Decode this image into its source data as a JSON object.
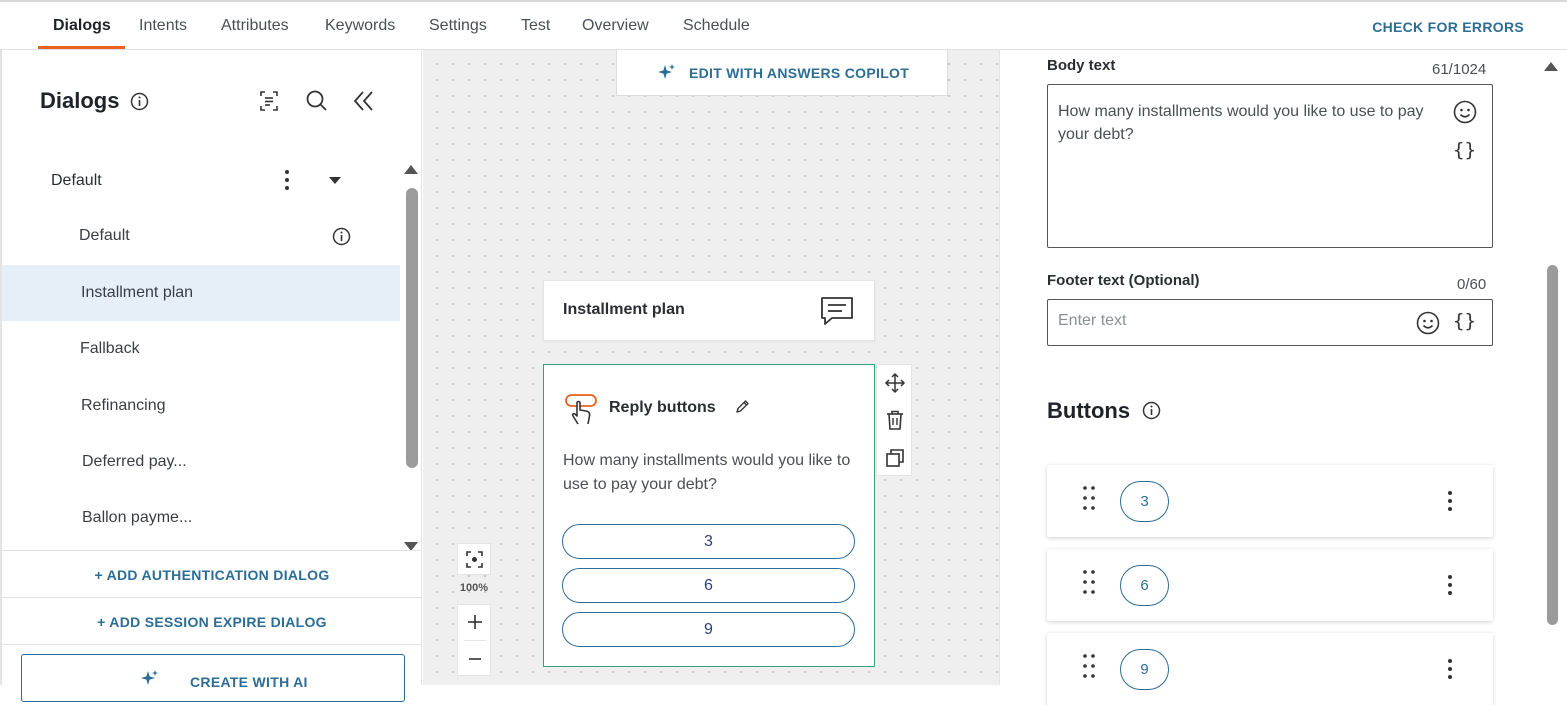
{
  "nav": {
    "tabs": [
      {
        "label": "Dialogs",
        "active": true
      },
      {
        "label": "Intents"
      },
      {
        "label": "Attributes"
      },
      {
        "label": "Keywords"
      },
      {
        "label": "Settings"
      },
      {
        "label": "Test"
      },
      {
        "label": "Overview"
      },
      {
        "label": "Schedule"
      }
    ],
    "check_errors": "CHECK FOR ERRORS"
  },
  "sidebar": {
    "title": "Dialogs",
    "group": "Default",
    "items": [
      {
        "label": "Default",
        "has_info": true
      },
      {
        "label": "Installment plan",
        "selected": true
      },
      {
        "label": "Fallback"
      },
      {
        "label": "Refinancing"
      },
      {
        "label": "Deferred pay..."
      },
      {
        "label": "Ballon payme..."
      }
    ],
    "add_auth": "+ ADD AUTHENTICATION DIALOG",
    "add_session": "+ ADD SESSION EXPIRE DIALOG",
    "create_ai": "CREATE WITH AI"
  },
  "canvas": {
    "copilot": "EDIT WITH ANSWERS COPILOT",
    "node_title": "Installment plan",
    "reply": {
      "title": "Reply buttons",
      "body": "How many installments would you like to use to pay your debt?",
      "options": [
        "3",
        "6",
        "9"
      ]
    },
    "zoom": "100%"
  },
  "editor": {
    "body_label": "Body text",
    "body_count": "61/1024",
    "body_text": "How many installments would you like to use to pay your debt?",
    "footer_label": "Footer text (Optional)",
    "footer_count": "0/60",
    "footer_placeholder": "Enter text",
    "braces": "{}",
    "buttons_title": "Buttons",
    "buttons": [
      "3",
      "6",
      "9"
    ]
  },
  "colors": {
    "accent_orange": "#e8621d",
    "link_blue": "#2c6d95",
    "selected_bg": "#e6eff8",
    "card_border_green": "#34a07a"
  }
}
